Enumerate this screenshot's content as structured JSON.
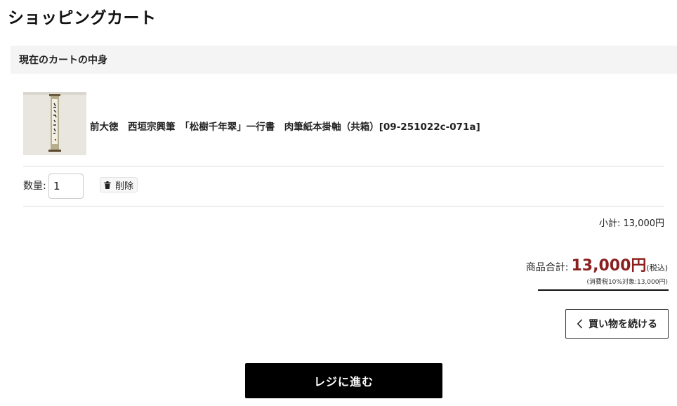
{
  "page": {
    "title": "ショッピングカート"
  },
  "cart": {
    "section_title": "現在のカートの中身",
    "item": {
      "name": "前大徳　西垣宗興筆　「松樹千年翠」一行書　肉筆紙本掛軸（共箱）[09-251022c-071a]",
      "thumbnail_icon": "hanging-scroll-image"
    },
    "quantity_label": "数量:",
    "quantity_value": "1",
    "delete_label": "削除",
    "delete_icon": "trash-icon",
    "subtotal": "小計: 13,000円"
  },
  "summary": {
    "total_label": "商品合計:",
    "total_amount": "13,000円",
    "total_suffix": "(税込)",
    "tax_note": "(消費税10%対象:13,000円)"
  },
  "actions": {
    "continue_label": "買い物を続ける",
    "continue_icon": "chevron-left-icon",
    "checkout_label": "レジに進む"
  },
  "colors": {
    "total_price": "#8b1f1f",
    "checkout_bg": "#000000",
    "header_bg": "#f4f4f4"
  }
}
